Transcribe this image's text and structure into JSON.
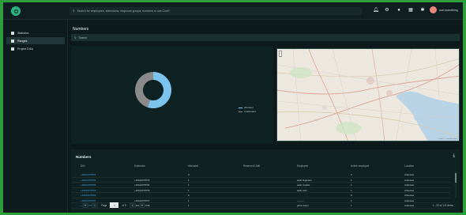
{
  "topbar": {
    "search_placeholder": "Search for employees, extensions, response groups, numbers or use Cmd+.",
    "icons": [
      "bell-icon",
      "gear-icon",
      "help-icon",
      "grid-icon",
      "info-icon"
    ],
    "user_name": "user.something"
  },
  "sidebar": {
    "items": [
      {
        "label": "Statistics",
        "icon": "stats-icon",
        "active": false
      },
      {
        "label": "Ranges",
        "icon": "ranges-icon",
        "active": true
      },
      {
        "label": "Project DIDs",
        "icon": "project-icon",
        "active": false
      }
    ]
  },
  "main": {
    "title": "Numbers",
    "filter_placeholder": "Search"
  },
  "donut": {
    "segments": [
      {
        "label": "Allocated",
        "fraction": 0.55,
        "color": "#7cc3ee"
      },
      {
        "label": "Unallocated",
        "fraction": 0.45,
        "color": "#8a8a8a"
      }
    ]
  },
  "map": {
    "attribution": "Leaflet | © OpenStreetMap"
  },
  "table": {
    "title": "Numbers",
    "columns": [
      "DID",
      "Extension",
      "Allocated",
      "Reserved Until",
      "Employee",
      "Active employee",
      "Location"
    ],
    "rows": [
      [
        "+19012079701",
        "",
        "0",
        "",
        "",
        "0",
        "Arkansas"
      ],
      [
        "+19012079703",
        "+19012079703",
        "1",
        "",
        "aelle.tingmann",
        "1",
        "Arkansas"
      ],
      [
        "+19012079704",
        "+19012079704",
        "1",
        "",
        "aelle.mueller",
        "1",
        "Arkansas"
      ],
      [
        "+19012079705",
        "+19012079705",
        "1",
        "",
        "aelle.ruan",
        "1",
        "Arkansas"
      ],
      [
        "+19012079706",
        "",
        "0",
        "",
        "",
        "0",
        "Arkansas"
      ],
      [
        "+19012079707",
        "+19012079707",
        "1",
        "",
        "———",
        "1",
        "Arkansas"
      ],
      [
        "+19012079708",
        "+19012079708",
        "1",
        "",
        "jahnn.lowry",
        "1",
        "Arkansas"
      ]
    ],
    "pager": {
      "page_label": "Page",
      "page_value": "1",
      "of_label": "of 9",
      "first": "«",
      "prev": "‹",
      "next": "›",
      "last": "»"
    },
    "count_text": "1 - 20 of 121 items",
    "download_icon": "download-icon"
  }
}
